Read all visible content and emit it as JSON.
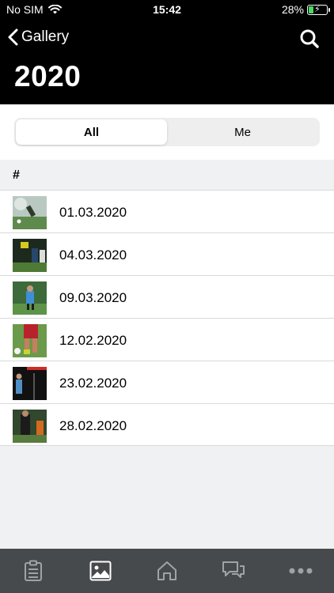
{
  "status_bar": {
    "carrier": "No SIM",
    "time": "15:42",
    "battery_percent": "28%",
    "battery_level": 0.28
  },
  "nav": {
    "back_label": "Gallery",
    "title": "2020"
  },
  "segments": [
    {
      "label": "All",
      "active": true
    },
    {
      "label": "Me",
      "active": false
    }
  ],
  "section": {
    "header": "#"
  },
  "items": [
    {
      "date": "01.03.2020"
    },
    {
      "date": "04.03.2020"
    },
    {
      "date": "09.03.2020"
    },
    {
      "date": "12.02.2020"
    },
    {
      "date": "23.02.2020"
    },
    {
      "date": "28.02.2020"
    }
  ],
  "tab_bar": {
    "tabs": [
      {
        "icon": "clipboard-icon",
        "active": false
      },
      {
        "icon": "gallery-icon",
        "active": true
      },
      {
        "icon": "home-icon",
        "active": false
      },
      {
        "icon": "chat-icon",
        "active": false
      },
      {
        "icon": "more-icon",
        "active": false
      }
    ]
  },
  "colors": {
    "header_bg": "#000000",
    "tab_bar_bg": "#474a4c",
    "tab_icon": "#9fa3a6",
    "tab_icon_active": "#ffffff",
    "page_bg": "#eff1f2",
    "battery_fill": "#4cd964"
  }
}
